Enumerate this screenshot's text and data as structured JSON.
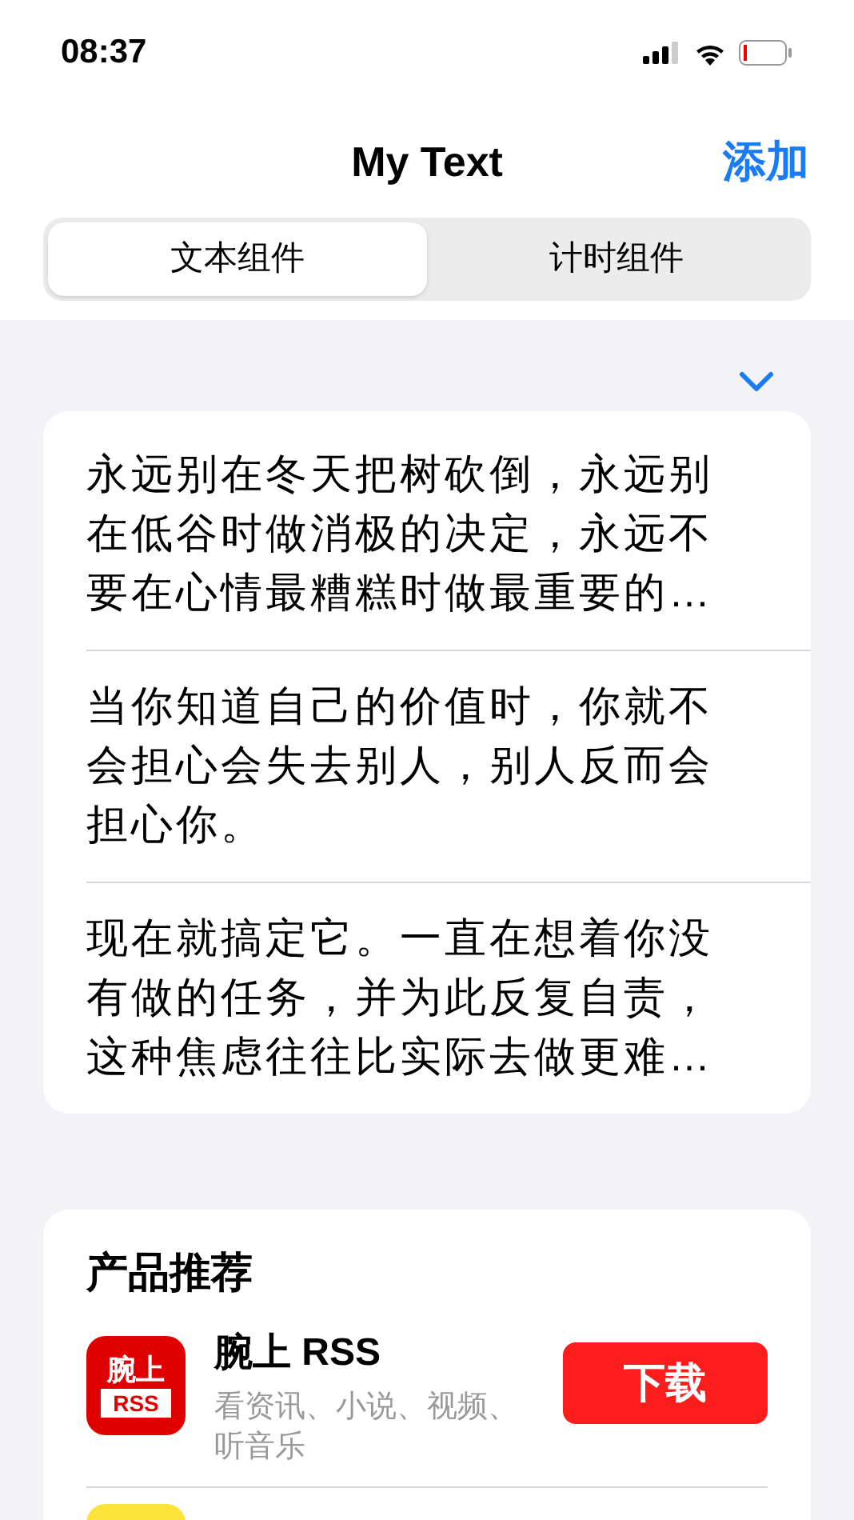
{
  "status_bar": {
    "time": "08:37"
  },
  "nav": {
    "title": "My Text",
    "action": "添加"
  },
  "tabs": [
    {
      "label": "文本组件",
      "selected": true
    },
    {
      "label": "计时组件",
      "selected": false
    }
  ],
  "texts": [
    "永远别在冬天把树砍倒，永远别在低谷时做消极的决定，永远不要在心情最糟糕时做最重要的…",
    "当你知道自己的价值时，你就不会担心会失去别人，别人反而会担心你。",
    "现在就搞定它。一直在想着你没有做的任务，并为此反复自责，这种焦虑往往比实际去做更难…"
  ],
  "recommend": {
    "title": "产品推荐",
    "apps": [
      {
        "icon_text": [
          "腕上",
          "RSS"
        ],
        "name": "腕上 RSS",
        "description": "看资讯、小说、视频、听音乐",
        "button": "下载"
      }
    ]
  }
}
